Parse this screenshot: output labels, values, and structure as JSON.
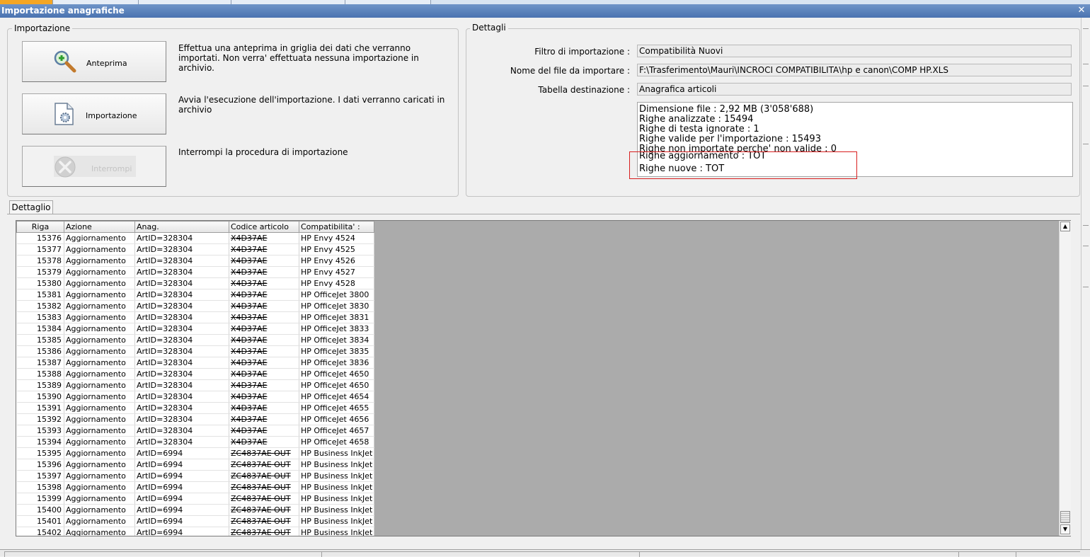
{
  "window": {
    "title": "Importazione anagrafiche",
    "close_glyph": "✕"
  },
  "importazione": {
    "label": "Importazione",
    "anteprima": {
      "label": "Anteprima",
      "description": "Effettua una anteprima in griglia dei dati che verranno importati. Non verra' effettuata nessuna importazione in archivio.",
      "icon": "magnifier-plus-icon"
    },
    "importa": {
      "label": "Importazione",
      "description": "Avvia l'esecuzione dell'importazione. I dati verranno caricati in archivio",
      "icon": "document-gear-icon"
    },
    "interrompi": {
      "label": "Interrompi",
      "description": "Interrompi la procedura di importazione",
      "icon": "stop-tools-icon"
    }
  },
  "dettagli": {
    "label": "Dettagli",
    "filtro": {
      "label": "Filtro di importazione :",
      "value": "Compatibilità Nuovi"
    },
    "file": {
      "label": "Nome del file da importare :",
      "value": "F:\\Trasferimento\\Mauri\\INCROCI COMPATIBILITA\\hp e canon\\COMP HP.XLS"
    },
    "tabella": {
      "label": "Tabella destinazione :",
      "value": "Anagrafica articoli"
    },
    "info": [
      "Dimensione file : 2,92 MB (3'058'688)",
      "Righe analizzate : 15494",
      "Righe di testa ignorate : 1",
      "Righe valide per l'importazione : 15493",
      "Righe non importate perche' non valide : 0",
      "Righe aggiornamento : TOT",
      "Righe nuove : TOT"
    ]
  },
  "tab": {
    "label": "Dettaglio"
  },
  "grid": {
    "columns": [
      "Riga",
      "Azione",
      "Anag.",
      "Codice articolo",
      "Compatibilita' :"
    ],
    "rows": [
      [
        "15376",
        "Aggiornamento",
        "ArtID=328304",
        "X4D37AE",
        "HP Envy 4524"
      ],
      [
        "15377",
        "Aggiornamento",
        "ArtID=328304",
        "X4D37AE",
        "HP Envy 4525"
      ],
      [
        "15378",
        "Aggiornamento",
        "ArtID=328304",
        "X4D37AE",
        "HP Envy 4526"
      ],
      [
        "15379",
        "Aggiornamento",
        "ArtID=328304",
        "X4D37AE",
        "HP Envy 4527"
      ],
      [
        "15380",
        "Aggiornamento",
        "ArtID=328304",
        "X4D37AE",
        "HP Envy 4528"
      ],
      [
        "15381",
        "Aggiornamento",
        "ArtID=328304",
        "X4D37AE",
        "HP OfficeJet 3800"
      ],
      [
        "15382",
        "Aggiornamento",
        "ArtID=328304",
        "X4D37AE",
        "HP OfficeJet 3830"
      ],
      [
        "15383",
        "Aggiornamento",
        "ArtID=328304",
        "X4D37AE",
        "HP OfficeJet 3831"
      ],
      [
        "15384",
        "Aggiornamento",
        "ArtID=328304",
        "X4D37AE",
        "HP OfficeJet 3833"
      ],
      [
        "15385",
        "Aggiornamento",
        "ArtID=328304",
        "X4D37AE",
        "HP OfficeJet 3834"
      ],
      [
        "15386",
        "Aggiornamento",
        "ArtID=328304",
        "X4D37AE",
        "HP OfficeJet 3835"
      ],
      [
        "15387",
        "Aggiornamento",
        "ArtID=328304",
        "X4D37AE",
        "HP OfficeJet 3836"
      ],
      [
        "15388",
        "Aggiornamento",
        "ArtID=328304",
        "X4D37AE",
        "HP OfficeJet 4650"
      ],
      [
        "15389",
        "Aggiornamento",
        "ArtID=328304",
        "X4D37AE",
        "HP OfficeJet 4650"
      ],
      [
        "15390",
        "Aggiornamento",
        "ArtID=328304",
        "X4D37AE",
        "HP OfficeJet 4654"
      ],
      [
        "15391",
        "Aggiornamento",
        "ArtID=328304",
        "X4D37AE",
        "HP OfficeJet 4655"
      ],
      [
        "15392",
        "Aggiornamento",
        "ArtID=328304",
        "X4D37AE",
        "HP OfficeJet 4656"
      ],
      [
        "15393",
        "Aggiornamento",
        "ArtID=328304",
        "X4D37AE",
        "HP OfficeJet 4657"
      ],
      [
        "15394",
        "Aggiornamento",
        "ArtID=328304",
        "X4D37AE",
        "HP OfficeJet 4658"
      ],
      [
        "15395",
        "Aggiornamento",
        "ArtID=6994",
        "ZC4837AE OUT",
        "HP Business InkJet"
      ],
      [
        "15396",
        "Aggiornamento",
        "ArtID=6994",
        "ZC4837AE OUT",
        "HP Business InkJet"
      ],
      [
        "15397",
        "Aggiornamento",
        "ArtID=6994",
        "ZC4837AE OUT",
        "HP Business InkJet"
      ],
      [
        "15398",
        "Aggiornamento",
        "ArtID=6994",
        "ZC4837AE OUT",
        "HP Business InkJet"
      ],
      [
        "15399",
        "Aggiornamento",
        "ArtID=6994",
        "ZC4837AE OUT",
        "HP Business InkJet"
      ],
      [
        "15400",
        "Aggiornamento",
        "ArtID=6994",
        "ZC4837AE OUT",
        "HP Business InkJet"
      ],
      [
        "15401",
        "Aggiornamento",
        "ArtID=6994",
        "ZC4837AE OUT",
        "HP Business InkJet"
      ],
      [
        "15402",
        "Aggiornamento",
        "ArtID=6994",
        "ZC4837AE OUT",
        "HP Business InkJet"
      ]
    ]
  },
  "scroll": {
    "up_glyph": "▲",
    "down_glyph": "▼"
  },
  "colors": {
    "titlebar": "#4a73b0",
    "highlight_box": "#d81e1e",
    "grid_empty": "#ababab"
  }
}
